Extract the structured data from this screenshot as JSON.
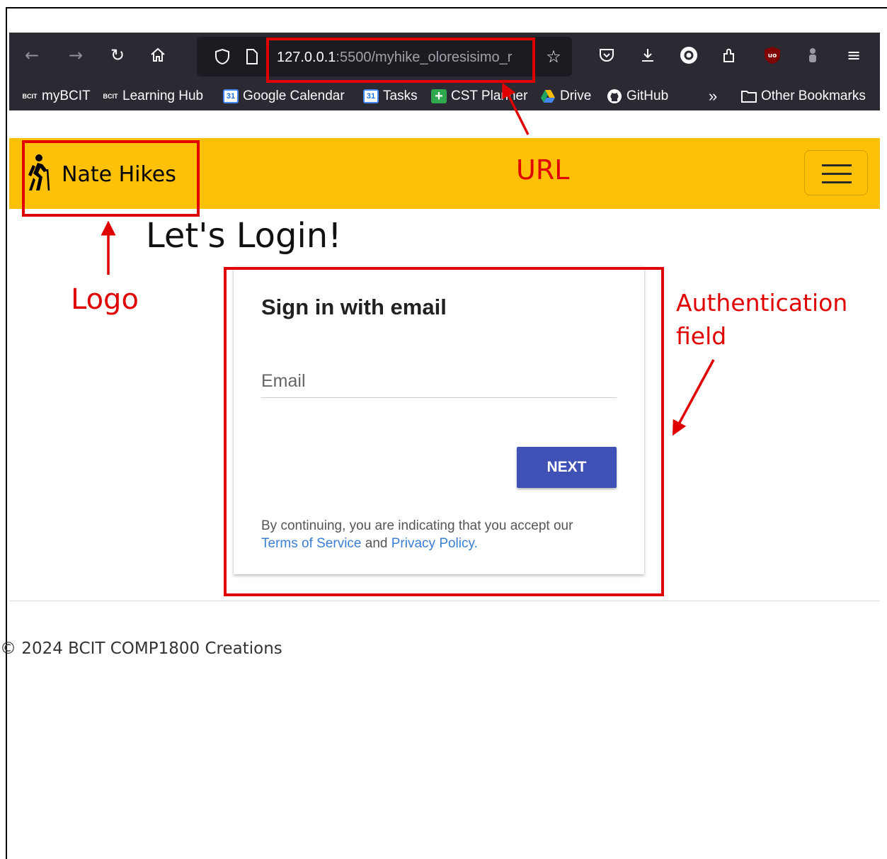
{
  "browser": {
    "url_host": "127.0.0.1",
    "url_path": ":5500/myhike_oloresisimo_r",
    "bookmarks": [
      {
        "label": "myBCIT",
        "icon": "bcit-icon",
        "icon_text": "BCIT"
      },
      {
        "label": "Learning Hub",
        "icon": "bcit-icon",
        "icon_text": "BCIT"
      },
      {
        "label": "Google Calendar",
        "icon": "calendar-icon",
        "icon_text": "31"
      },
      {
        "label": "Tasks",
        "icon": "calendar-icon",
        "icon_text": "31"
      },
      {
        "label": "CST Planner",
        "icon": "plus-icon",
        "icon_text": "+"
      },
      {
        "label": "Drive",
        "icon": "drive-icon",
        "icon_text": ""
      },
      {
        "label": "GitHub",
        "icon": "github-icon",
        "icon_text": ""
      }
    ],
    "other_bookmarks": "Other Bookmarks"
  },
  "navbar": {
    "brand": "Nate Hikes",
    "bg_color": "#ffc107"
  },
  "main": {
    "title": "Let's Login!"
  },
  "auth": {
    "title": "Sign in with email",
    "email_placeholder": "Email",
    "next_label": "NEXT",
    "tos_prefix": "By continuing, you are indicating that you accept our",
    "terms_link": "Terms of Service",
    "and_text": "and",
    "privacy_link": "Privacy Policy",
    "period": ".",
    "button_color": "#3f51b5"
  },
  "footer": {
    "text": "© 2024 BCIT COMP1800 Creations"
  },
  "annotations": {
    "url": "URL",
    "logo": "Logo",
    "auth_line1": "Authentication",
    "auth_line2": "field",
    "color": "#e00000"
  }
}
